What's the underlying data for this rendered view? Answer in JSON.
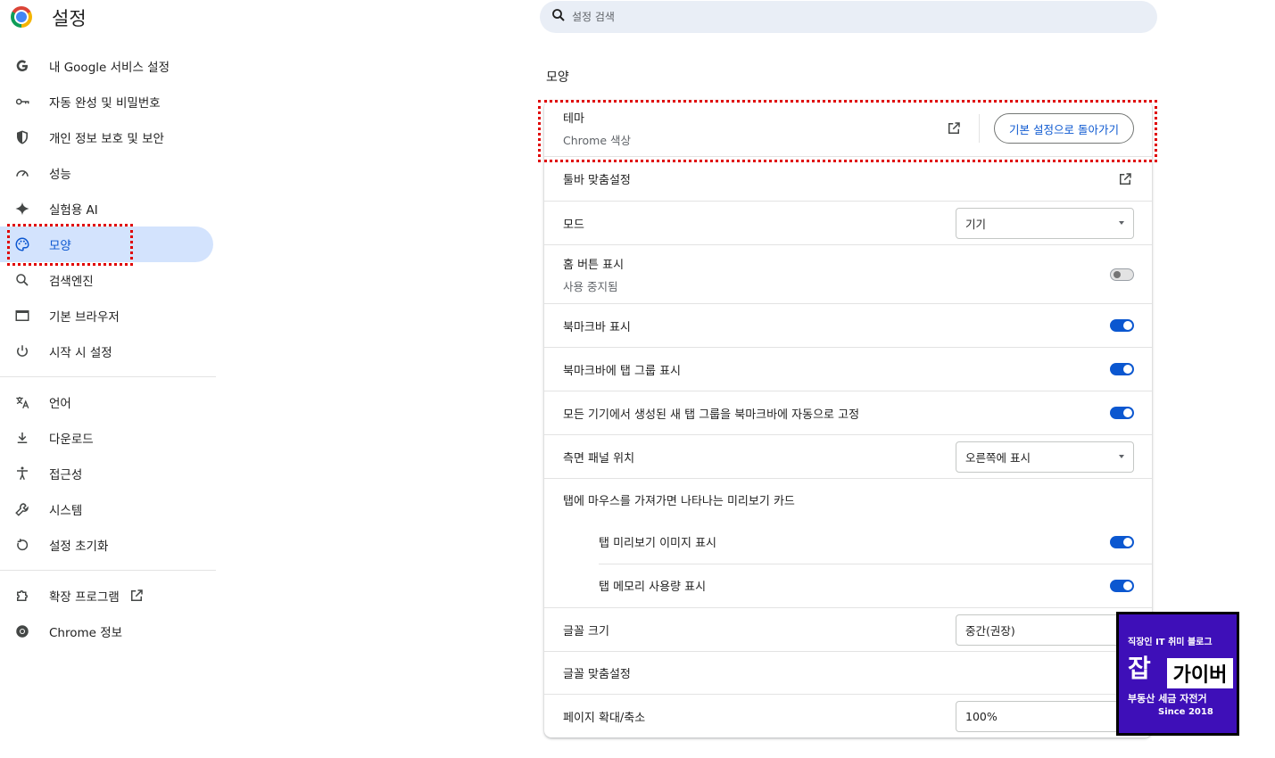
{
  "header": {
    "title": "설정",
    "search_placeholder": "설정 검색"
  },
  "sidebar": {
    "items": [
      {
        "label": "내 Google 서비스 설정",
        "icon": "google-g-icon"
      },
      {
        "label": "자동 완성 및 비밀번호",
        "icon": "key-icon"
      },
      {
        "label": "개인 정보 보호 및 보안",
        "icon": "shield-icon"
      },
      {
        "label": "성능",
        "icon": "speedometer-icon"
      },
      {
        "label": "실험용 AI",
        "icon": "sparkle-icon"
      },
      {
        "label": "모양",
        "icon": "palette-icon",
        "active": true
      },
      {
        "label": "검색엔진",
        "icon": "search-icon"
      },
      {
        "label": "기본 브라우저",
        "icon": "browser-window-icon"
      },
      {
        "label": "시작 시 설정",
        "icon": "power-icon"
      }
    ],
    "items2": [
      {
        "label": "언어",
        "icon": "translate-icon"
      },
      {
        "label": "다운로드",
        "icon": "download-icon"
      },
      {
        "label": "접근성",
        "icon": "accessibility-icon"
      },
      {
        "label": "시스템",
        "icon": "wrench-icon"
      },
      {
        "label": "설정 초기화",
        "icon": "reset-icon"
      }
    ],
    "items3": [
      {
        "label": "확장 프로그램",
        "icon": "puzzle-icon"
      },
      {
        "label": "Chrome 정보",
        "icon": "chrome-icon"
      }
    ]
  },
  "main": {
    "section_title": "모양",
    "theme": {
      "label": "테마",
      "sublabel": "Chrome 색상",
      "reset_label": "기본 설정으로 돌아가기"
    },
    "toolbar": {
      "label": "툴바 맞춤설정"
    },
    "mode": {
      "label": "모드",
      "value": "기기"
    },
    "home_button": {
      "label": "홈 버튼 표시",
      "sublabel": "사용 중지됨",
      "enabled": false
    },
    "bookmarks_bar": {
      "label": "북마크바 표시",
      "enabled": true
    },
    "tab_groups_bar": {
      "label": "북마크바에 탭 그룹 표시",
      "enabled": true
    },
    "auto_pin": {
      "label": "모든 기기에서 생성된 새 탭 그룹을 북마크바에 자동으로 고정",
      "enabled": true
    },
    "side_panel": {
      "label": "측면 패널 위치",
      "value": "오른쪽에 표시"
    },
    "hover_card": {
      "label": "탭에 마우스를 가져가면 나타나는 미리보기 카드"
    },
    "preview_image": {
      "label": "탭 미리보기 이미지 표시",
      "enabled": true
    },
    "memory_usage": {
      "label": "탭 메모리 사용량 표시",
      "enabled": true
    },
    "font_size": {
      "label": "글꼴 크기",
      "value": "중간(권장)"
    },
    "font_custom": {
      "label": "글꼴 맞춤설정"
    },
    "zoom": {
      "label": "페이지 확대/축소",
      "value": "100%"
    }
  },
  "watermark": {
    "line1": "직장인 IT 취미 블로그",
    "line2a": "잡",
    "line2b": "가이버",
    "line3": "부동산 세금 자전거",
    "line4": "Since 2018"
  },
  "colors": {
    "accent": "#0b57d0",
    "active_bg": "#d3e3fd",
    "highlight": "#e00000",
    "badge": "#3e0fb8"
  }
}
